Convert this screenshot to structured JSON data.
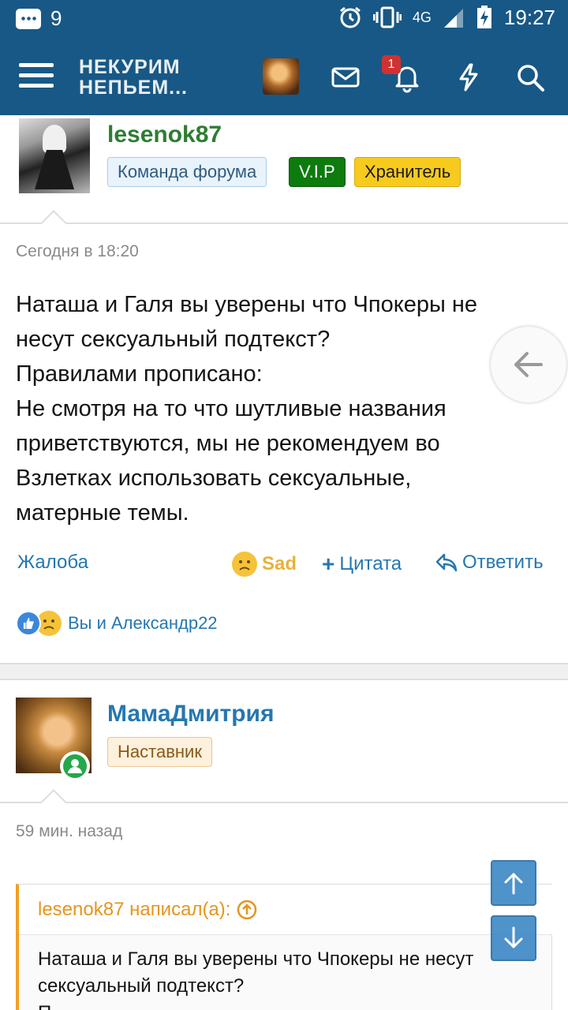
{
  "status_bar": {
    "notification_count": "9",
    "network": "4G",
    "time": "19:27"
  },
  "header": {
    "logo_line1": "НЕКУРИМ",
    "logo_line2": "НЕПЬЕМ...",
    "alerts_badge": "1",
    "icons": [
      "menu-icon",
      "avatar",
      "mail-icon",
      "bell-icon",
      "lightning-icon",
      "search-icon"
    ]
  },
  "post1": {
    "username": "lesenok87",
    "badges": [
      "Команда форума",
      "V.I.P",
      "Хранитель"
    ],
    "date": "Сегодня в 18:20",
    "lines": [
      "Наташа и Галя вы уверены что Чпокеры не",
      "несут сексуальный подтекст?",
      "Правилами прописано:",
      "Не смотря на то что шутливые названия",
      "приветствуются, мы не рекомендуем во",
      "Взлетках использовать сексуальные,",
      "матерные темы."
    ],
    "actions": {
      "report": "Жалоба",
      "reaction": "Sad",
      "quote": "Цитата",
      "reply": "Ответить"
    },
    "reactions_text": "Вы и Александр22"
  },
  "post2": {
    "username": "МамаДмитрия",
    "badge": "Наставник",
    "date": "59 мин. назад",
    "quote_author": "lesenok87 написал(а):",
    "quote_lines": [
      "Наташа и Галя вы уверены что Чпокеры не несут",
      "сексуальный подтекст?",
      "П"
    ]
  },
  "colors": {
    "header_bg": "#185886",
    "link": "#2577b1",
    "username_green": "#2e7d32",
    "vip_green": "#0d7b0d",
    "keeper_yellow": "#f6cb1d",
    "quote_accent": "#f2a023"
  }
}
